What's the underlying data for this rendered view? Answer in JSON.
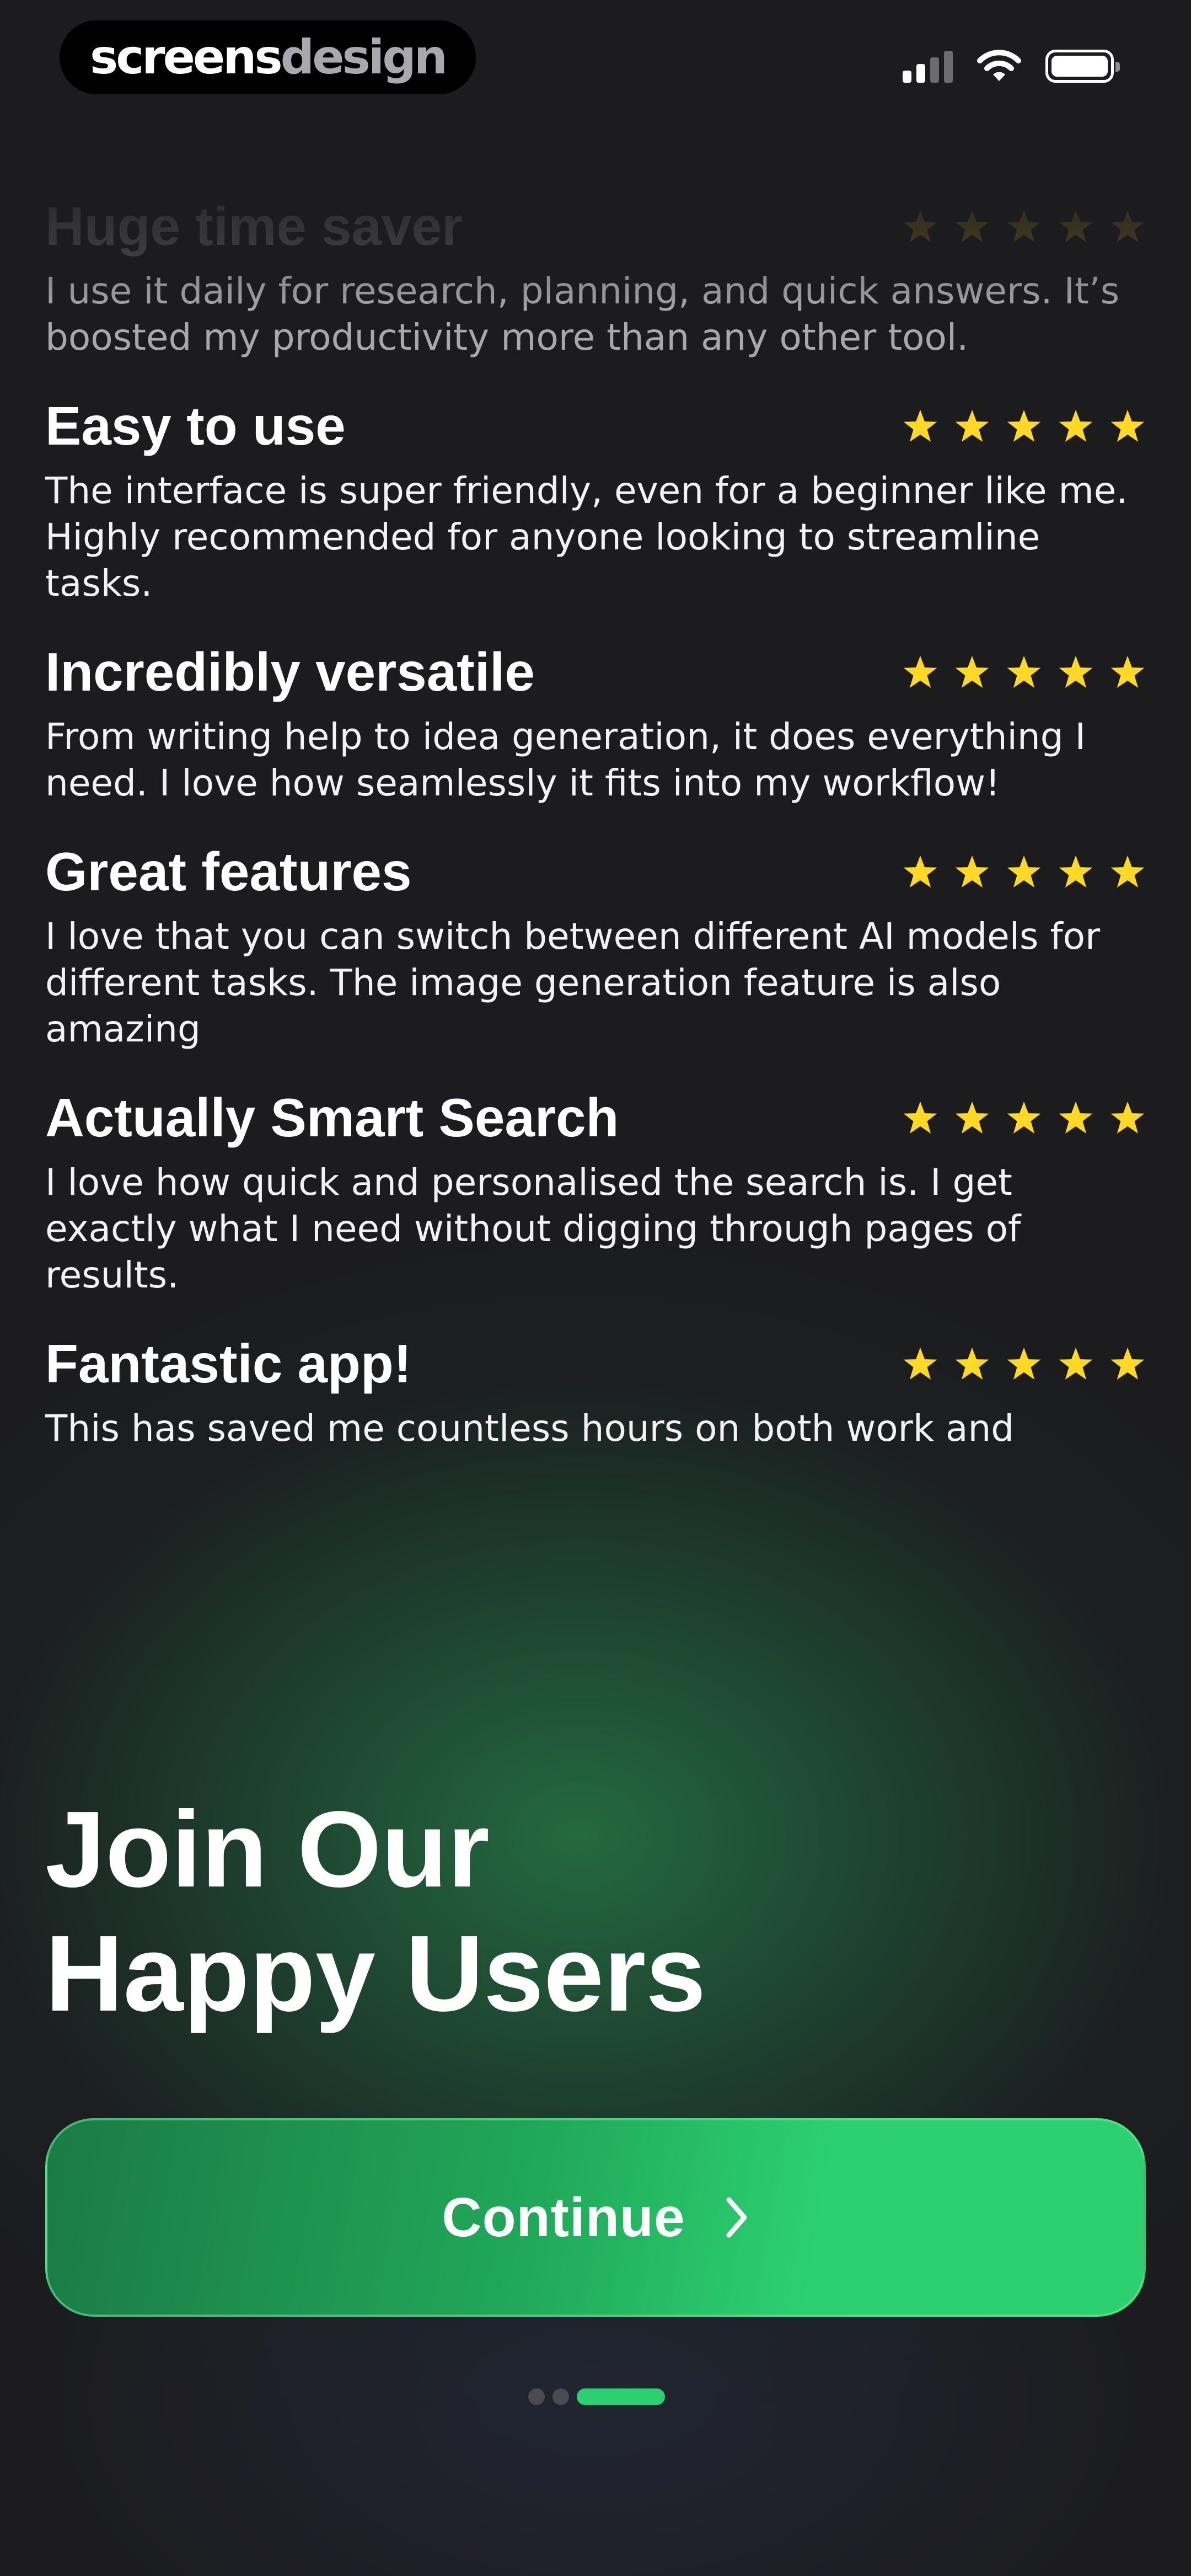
{
  "status_bar": {
    "brand_part1": "screens",
    "brand_part2": "design",
    "signal_icon": "cellular-signal-icon",
    "wifi_icon": "wifi-icon",
    "battery_icon": "battery-icon"
  },
  "reviews": [
    {
      "title": "Huge time saver",
      "rating": 5,
      "body": "I use it daily for research, planning, and quick answers. It’s boosted my productivity more than any other tool."
    },
    {
      "title": "Easy to use",
      "rating": 5,
      "body": "The interface is super friendly, even for a beginner like me. Highly recommended for anyone looking to streamline tasks."
    },
    {
      "title": "Incredibly versatile",
      "rating": 5,
      "body": "From writing help to idea generation, it does everything I need. I love how seamlessly it fits into my workflow!"
    },
    {
      "title": "Great features",
      "rating": 5,
      "body": "I love that you can switch between different AI models for different tasks. The image generation feature is also amazing"
    },
    {
      "title": "Actually Smart Search",
      "rating": 5,
      "body": "I love how quick and personalised the search is. I get exactly what I need without digging through pages of results."
    },
    {
      "title": "Fantastic app!",
      "rating": 5,
      "body": "This has saved me countless hours on both work and"
    }
  ],
  "headline": {
    "line1": "Join Our",
    "line2": "Happy Users"
  },
  "cta": {
    "label": "Continue",
    "icon": "chevron-right-icon"
  },
  "pager": {
    "total": 3,
    "active_index": 2
  },
  "colors": {
    "background": "#1c1c1e",
    "accent": "#2cd071",
    "star": "#ffd926",
    "glow": "#246e42"
  }
}
